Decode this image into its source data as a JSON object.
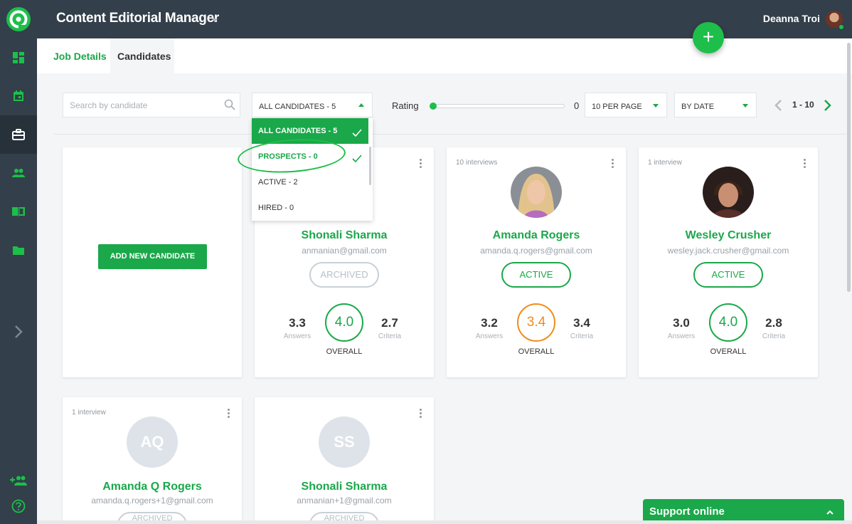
{
  "header": {
    "app_title": "Content Editorial Manager",
    "user_name": "Deanna Troi"
  },
  "tabs": [
    {
      "label": "Job Details",
      "active": false
    },
    {
      "label": "Candidates",
      "active": true
    }
  ],
  "sidebar": {
    "items": [
      "dashboard-icon",
      "calendar-icon",
      "briefcase-icon",
      "people-icon",
      "book-icon",
      "folder-icon"
    ],
    "active": "briefcase-icon",
    "expand": "chevron-right-icon",
    "bottom": [
      "add-user-icon",
      "help-icon"
    ]
  },
  "toolbar": {
    "search_placeholder": "Search by candidate",
    "candidate_filter": "ALL CANDIDATES - 5",
    "rating_label": "Rating",
    "rating_value": "0",
    "per_page": "10 PER PAGE",
    "sort": "BY DATE",
    "page_range": "1 - 10"
  },
  "filter_options": [
    {
      "label": "ALL CANDIDATES - 5",
      "selected": true
    },
    {
      "label": "PROSPECTS - 0",
      "selected": false,
      "checked": true
    },
    {
      "label": "ACTIVE - 2",
      "selected": false
    },
    {
      "label": "HIRED - 0",
      "selected": false
    }
  ],
  "add_candidate_label": "ADD NEW CANDIDATE",
  "candidates": [
    {
      "interviews": "",
      "name": "Shonali Sharma",
      "email": "anmanian@gmail.com",
      "status": "ARCHIVED",
      "answers": "3.3",
      "overall": "4.0",
      "criteria": "2.7"
    },
    {
      "interviews": "10 interviews",
      "name": "Amanda Rogers",
      "email": "amanda.q.rogers@gmail.com",
      "status": "ACTIVE",
      "answers": "3.2",
      "overall": "3.4",
      "criteria": "3.4"
    },
    {
      "interviews": "1 interview",
      "name": "Wesley Crusher",
      "email": "wesley.jack.crusher@gmail.com",
      "status": "ACTIVE",
      "answers": "3.0",
      "overall": "4.0",
      "criteria": "2.8"
    },
    {
      "interviews": "1 interview",
      "initials": "AQ",
      "name": "Amanda Q Rogers",
      "email": "amanda.q.rogers+1@gmail.com",
      "status": "ARCHIVED"
    },
    {
      "interviews": "",
      "initials": "SS",
      "name": "Shonali Sharma",
      "email": "anmanian+1@gmail.com",
      "status": "ARCHIVED"
    }
  ],
  "labels": {
    "answers": "Answers",
    "criteria": "Criteria",
    "overall": "OVERALL"
  },
  "support": {
    "label": "Support online"
  },
  "colors": {
    "brand_green": "#1aa84a",
    "sidebar": "#333f4a",
    "warning_orange": "#f08c1e"
  }
}
